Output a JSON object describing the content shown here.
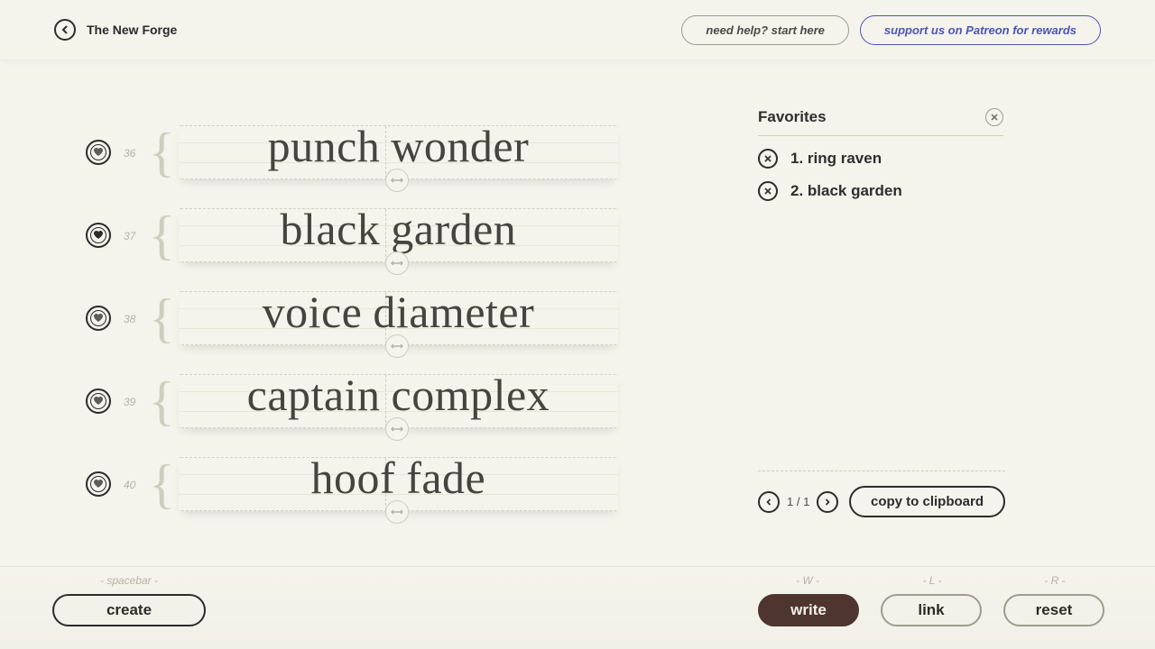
{
  "header": {
    "title": "The New Forge",
    "help_label": "need help? start here",
    "patreon_label": "support us on Patreon for rewards"
  },
  "rows": [
    {
      "index": "36",
      "w1": "punch",
      "w2": "wonder",
      "fav": false
    },
    {
      "index": "37",
      "w1": "black",
      "w2": "garden",
      "fav": true
    },
    {
      "index": "38",
      "w1": "voice",
      "w2": "diameter",
      "fav": false
    },
    {
      "index": "39",
      "w1": "captain",
      "w2": "complex",
      "fav": false
    },
    {
      "index": "40",
      "w1": "hoof",
      "w2": "fade",
      "fav": false
    }
  ],
  "favorites": {
    "title": "Favorites",
    "items": [
      {
        "label": "1. ring raven"
      },
      {
        "label": "2.  black garden"
      }
    ],
    "pager": "1 / 1",
    "copy_label": "copy to clipboard"
  },
  "bottom": {
    "create_hint": "- spacebar -",
    "write_hint": "- W -",
    "link_hint": "- L -",
    "reset_hint": "- R -",
    "create_label": "create",
    "write_label": "write",
    "link_label": "link",
    "reset_label": "reset"
  }
}
